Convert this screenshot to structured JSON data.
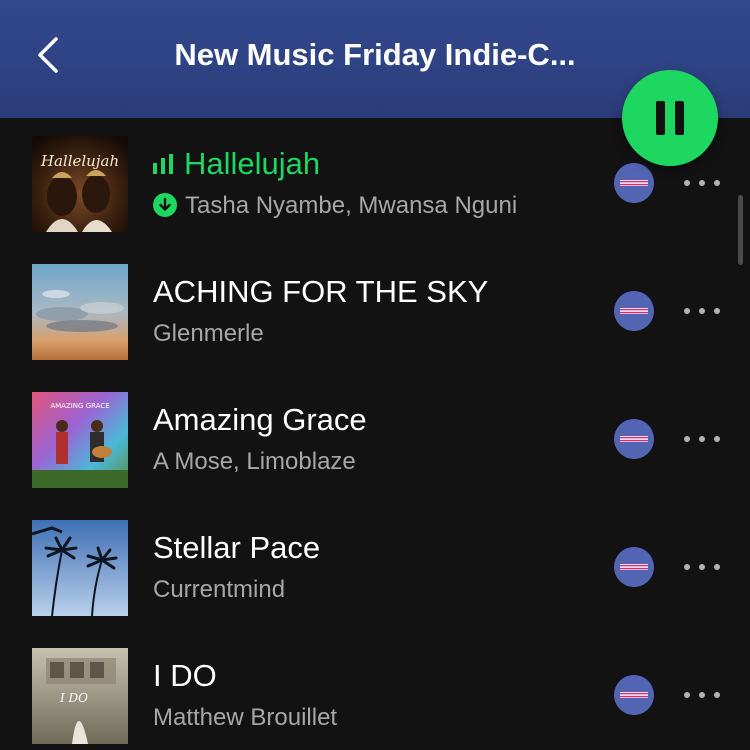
{
  "header": {
    "title": "New Music Friday Indie-C..."
  },
  "icons": {
    "back": "chevron-left-icon",
    "pause": "pause-icon",
    "more": "more-horizontal-icon",
    "download": "downloaded-icon",
    "now_playing": "equalizer-icon"
  },
  "colors": {
    "accent_green": "#1ed760",
    "header_blue": "#2e4283",
    "background": "#121212",
    "secondary_text": "#a7a7a7"
  },
  "tracks": [
    {
      "title": "Hallelujah",
      "artist": "Tasha Nyambe, Mwansa Nguni",
      "playing": true,
      "downloaded": true,
      "cover_text": "Hallelujah"
    },
    {
      "title": "ACHING FOR THE SKY",
      "artist": "Glenmerle",
      "playing": false,
      "downloaded": false
    },
    {
      "title": "Amazing Grace",
      "artist": "A Mose, Limoblaze",
      "playing": false,
      "downloaded": false,
      "cover_text": "AMAZING GRACE"
    },
    {
      "title": "Stellar Pace",
      "artist": "Currentmind",
      "playing": false,
      "downloaded": false
    },
    {
      "title": "I DO",
      "artist": "Matthew Brouillet",
      "playing": false,
      "downloaded": false,
      "cover_text": "I DO"
    }
  ]
}
